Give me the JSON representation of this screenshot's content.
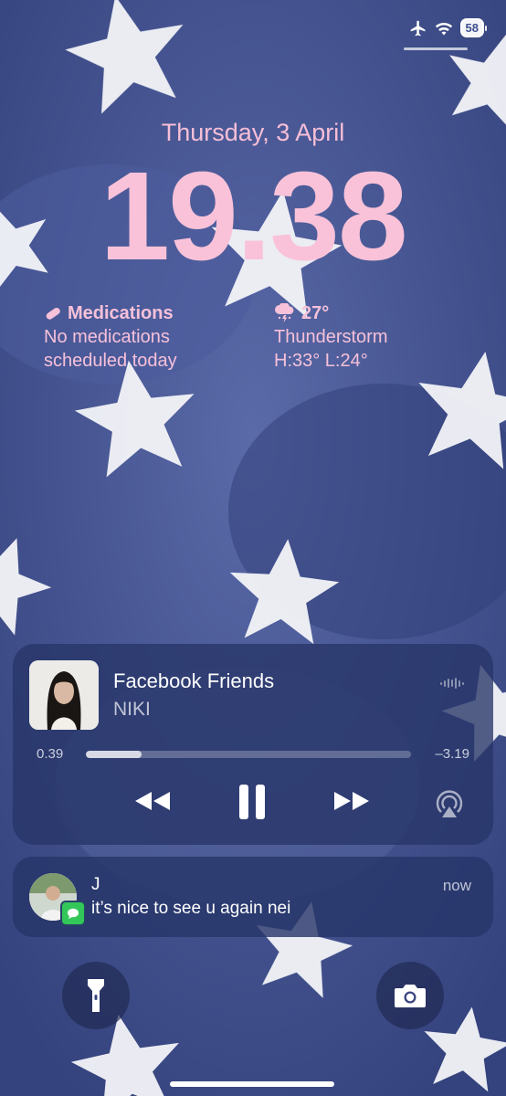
{
  "status_bar": {
    "battery": "58",
    "icons": [
      "airplane-icon",
      "wifi-icon"
    ]
  },
  "lock_screen": {
    "date": "Thursday, 3 April",
    "time": "19.38"
  },
  "widgets": {
    "medications": {
      "title": "Medications",
      "line1": "No medications",
      "line2": "scheduled today",
      "icon": "pill-icon"
    },
    "weather": {
      "temp": "27°",
      "condition": "Thunderstorm",
      "range": "H:33° L:24°",
      "icon": "thunderstorm-icon"
    }
  },
  "now_playing": {
    "title": "Facebook Friends",
    "artist": "NIKI",
    "elapsed": "0.39",
    "remaining": "–3.19",
    "progress": 0.17
  },
  "notification": {
    "sender": "J",
    "message": "it’s nice to see u again nei",
    "time": "now",
    "app_icon": "messages-icon"
  },
  "quick_actions": [
    "flashlight-icon",
    "camera-icon"
  ],
  "colors": {
    "accent_pink": "#f7bfd7",
    "wallpaper_blue": "#3f4f8e",
    "messages_green": "#33c759"
  }
}
